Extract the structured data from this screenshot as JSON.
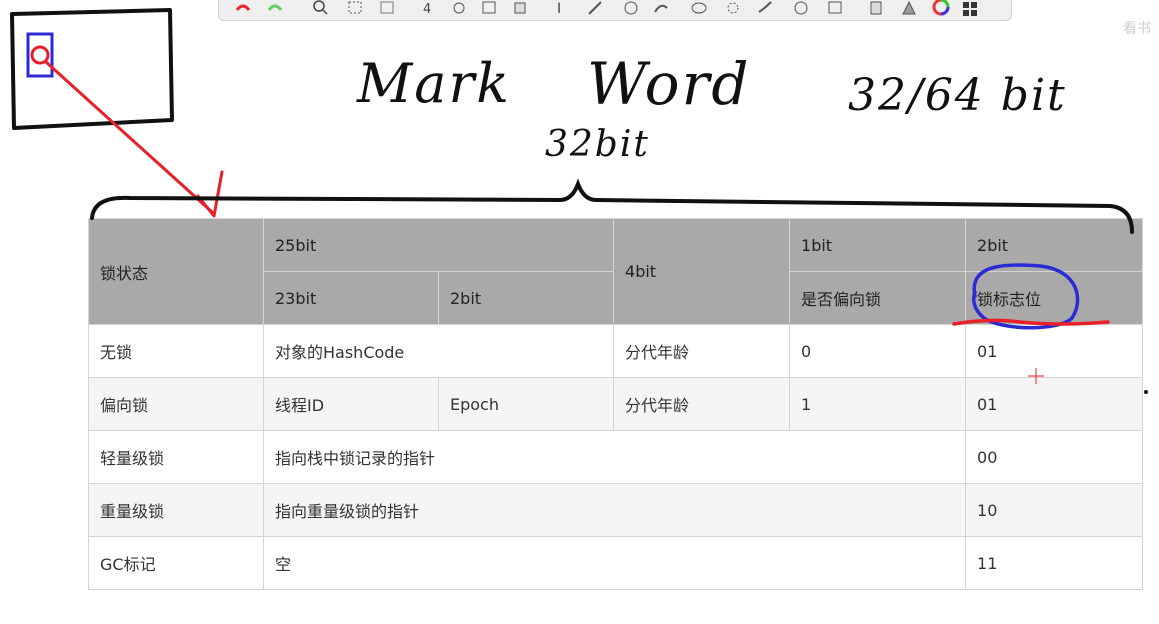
{
  "toolbar": {
    "icons": [
      "undo-icon",
      "redo-icon",
      "zoom-icon",
      "select-rect-icon",
      "select-icon",
      "text-icon",
      "move-icon",
      "lasso-icon",
      "eraser-icon",
      "type-icon",
      "pen-icon",
      "marker-icon",
      "brush-icon",
      "table-icon",
      "shapes-icon",
      "arrow-icon",
      "circle-icon",
      "crop-icon",
      "copy-icon",
      "fill-icon",
      "color-wheel-icon",
      "palette-icon"
    ]
  },
  "watermark": "看书",
  "handwriting": {
    "title_a": "Mark",
    "title_b": "Word",
    "bits": "32/64 bit",
    "brace_label": "32bit"
  },
  "table": {
    "header": {
      "lock_state": "锁状态",
      "bits_25": "25bit",
      "bits_23": "23bit",
      "bits_2a": "2bit",
      "bits_4": "4bit",
      "bits_1": "1bit",
      "bias_flag": "是否偏向锁",
      "bits_2b": "2bit",
      "lock_flag": "锁标志位"
    },
    "rows": [
      {
        "state": "无锁",
        "c1": "对象的HashCode",
        "age": "分代年龄",
        "biased": "0",
        "flag": "01"
      },
      {
        "state": "偏向锁",
        "thread": "线程ID",
        "epoch": "Epoch",
        "age": "分代年龄",
        "biased": "1",
        "flag": "01"
      },
      {
        "state": "轻量级锁",
        "c1": "指向栈中锁记录的指针",
        "flag": "00"
      },
      {
        "state": "重量级锁",
        "c1": "指向重量级锁的指针",
        "flag": "10"
      },
      {
        "state": "GC标记",
        "c1": "空",
        "flag": "11"
      }
    ]
  },
  "colors": {
    "header_bg": "#a9a9a9",
    "annotation_red": "#e8202a",
    "annotation_blue": "#2b2bd6",
    "ink": "#111111"
  }
}
